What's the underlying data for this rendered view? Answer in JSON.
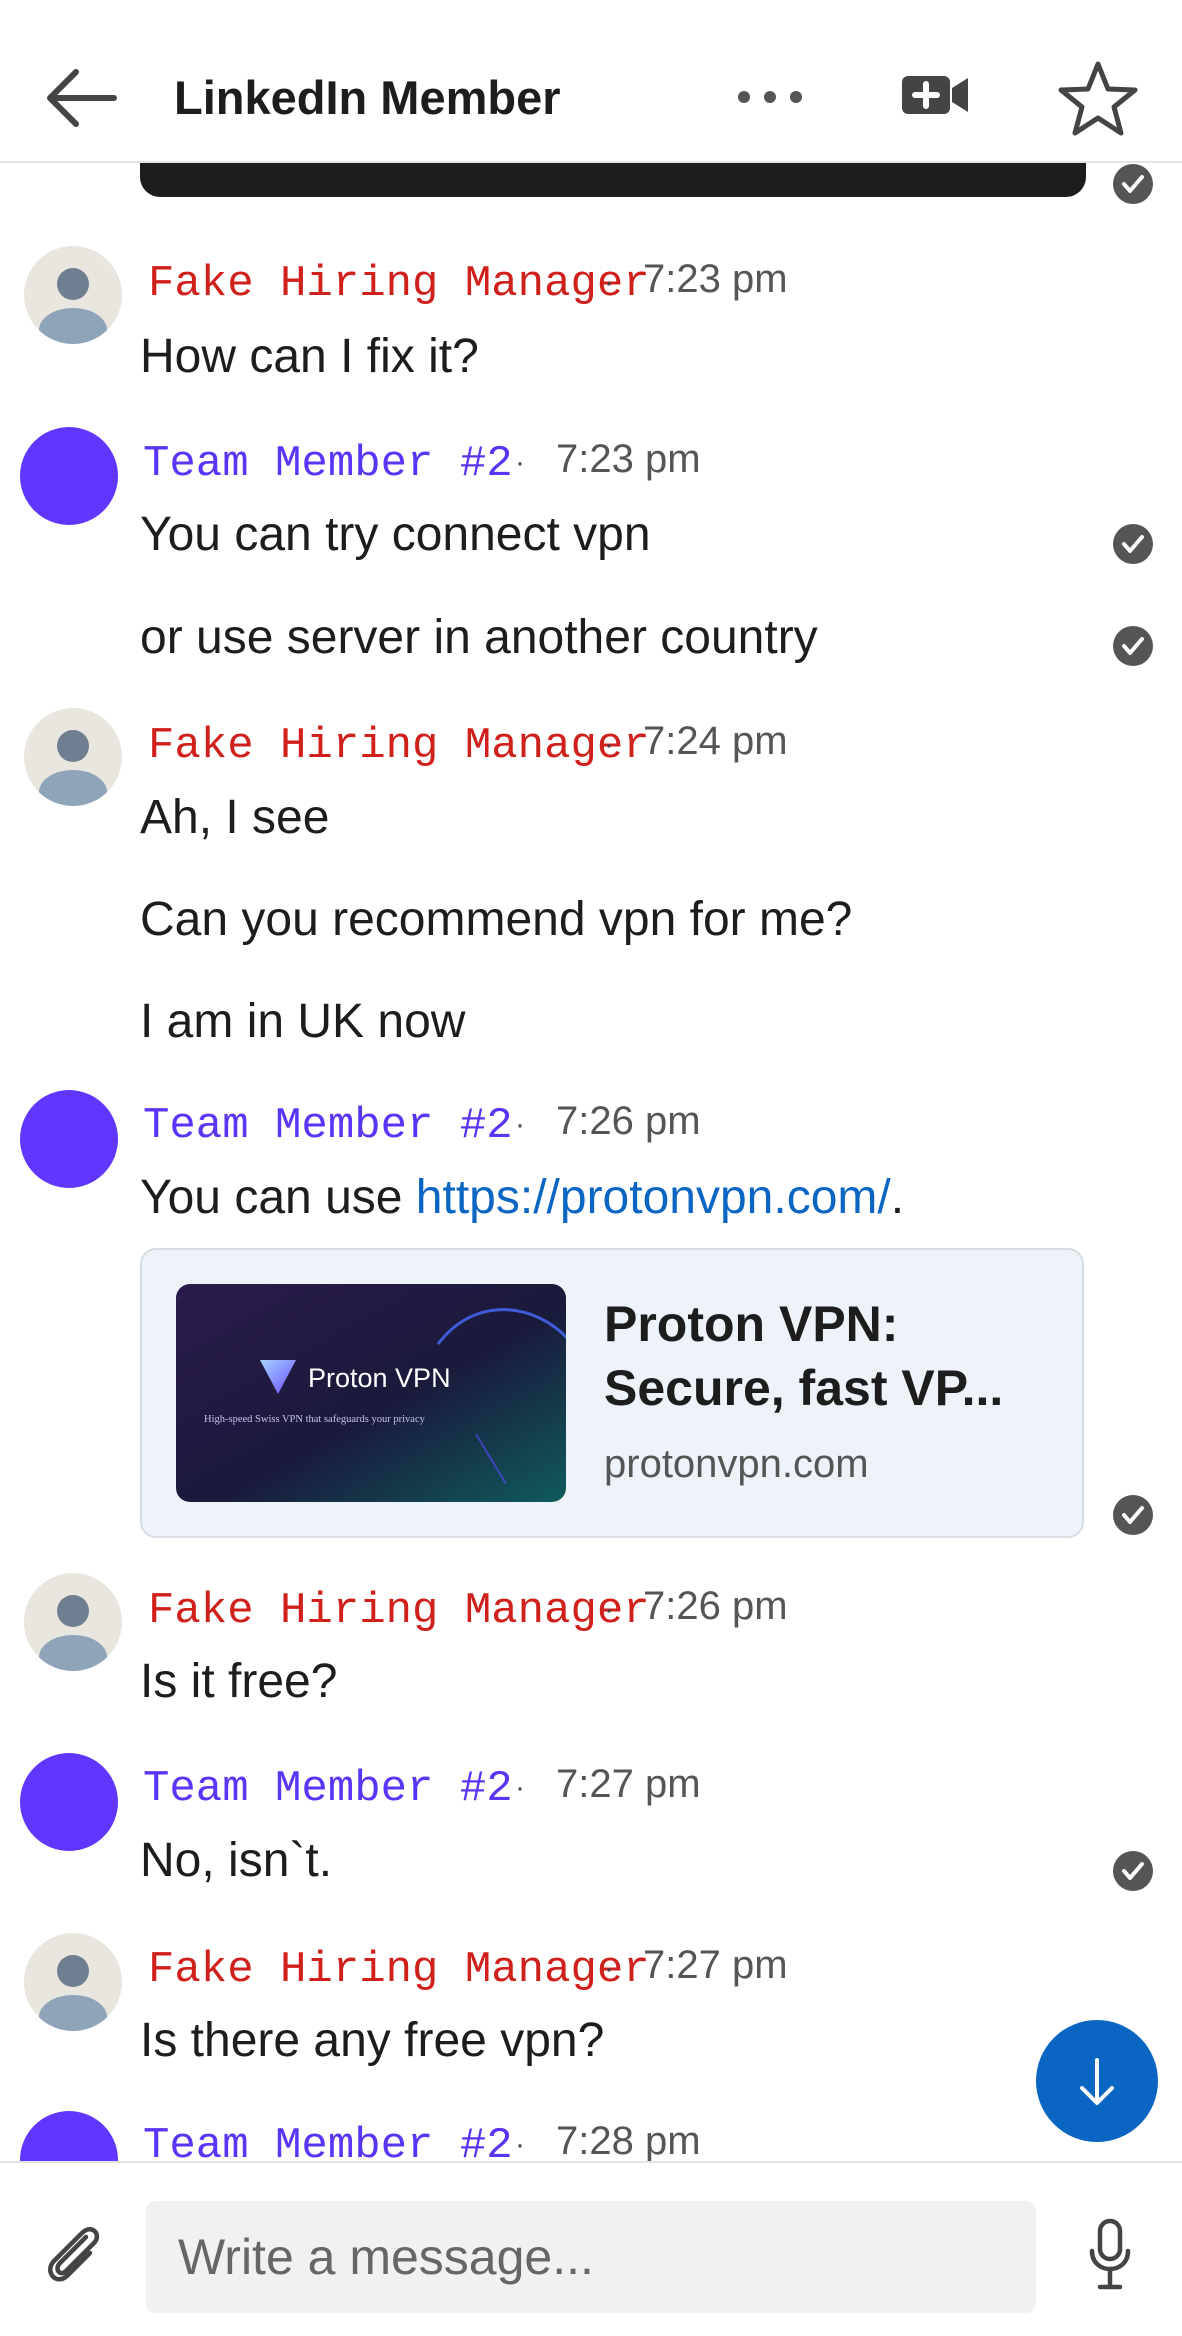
{
  "header": {
    "title": "LinkedIn Member"
  },
  "icons": {
    "back": "arrow-left-icon",
    "more": "more-horizontal-icon",
    "video": "video-call-icon",
    "star": "star-icon",
    "read": "read-receipt-check-icon",
    "attach": "paperclip-icon",
    "mic": "microphone-icon",
    "scroll_down": "arrow-down-icon"
  },
  "colors": {
    "fake_sender": "#d0201b",
    "team_sender": "#5b35f5",
    "link": "#0a66c2",
    "fab": "#0a66c2"
  },
  "thread": {
    "groups": [
      {
        "sender": "Fake Hiring Manager",
        "separator": "·",
        "time": "7:23 pm",
        "messages": [
          "How can I fix it?"
        ]
      },
      {
        "sender": "Team Member #2",
        "separator": "·",
        "time": "7:23 pm",
        "messages": [
          "You can try connect vpn",
          "or use server in another country"
        ]
      },
      {
        "sender": "Fake Hiring Manager",
        "separator": "·",
        "time": "7:24 pm",
        "messages": [
          "Ah, I see",
          "Can you recommend vpn for me?",
          "I am in UK now"
        ]
      },
      {
        "sender": "Team Member #2",
        "separator": "·",
        "time": "7:26 pm",
        "message_prefix": "You can use ",
        "link_text": "https://protonvpn.com/",
        "message_suffix": ".",
        "preview": {
          "brand": "Proton VPN",
          "tagline": "High-speed Swiss VPN that safeguards your privacy",
          "title": "Proton VPN: Secure, fast VP...",
          "domain": "protonvpn.com"
        }
      },
      {
        "sender": "Fake Hiring Manager",
        "separator": "·",
        "time": "7:26 pm",
        "messages": [
          "Is it free?"
        ]
      },
      {
        "sender": "Team Member #2",
        "separator": "·",
        "time": "7:27 pm",
        "messages": [
          "No, isn`t."
        ]
      },
      {
        "sender": "Fake Hiring Manager",
        "separator": "·",
        "time": "7:27 pm",
        "messages": [
          "Is there any free vpn?"
        ]
      },
      {
        "sender": "Team Member #2",
        "separator": "·",
        "time": "7:28 pm",
        "messages": []
      }
    ]
  },
  "composer": {
    "placeholder": "Write a message..."
  }
}
